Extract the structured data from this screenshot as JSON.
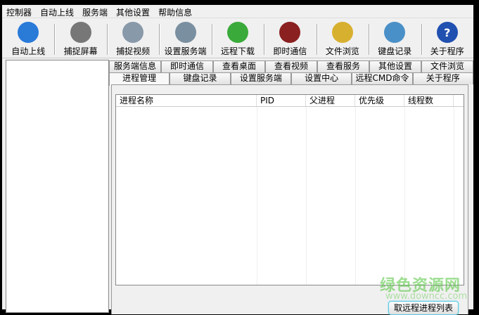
{
  "menu": [
    "控制器",
    "自动上线",
    "服务端",
    "其他设置",
    "帮助信息"
  ],
  "toolbar": [
    {
      "label": "自动上线",
      "icon": "globe-icon",
      "color": "#2a7ad8"
    },
    {
      "label": "捕捉屏幕",
      "icon": "camera-icon",
      "color": "#777"
    },
    {
      "label": "捕捉视频",
      "icon": "webcam-icon",
      "color": "#8899aa"
    },
    {
      "label": "设置服务端",
      "icon": "toolbox-icon",
      "color": "#7a8fa0"
    },
    {
      "label": "远程下载",
      "icon": "download-icon",
      "color": "#3aaa3a"
    },
    {
      "label": "即时通信",
      "icon": "heart-icon",
      "color": "#8a2020"
    },
    {
      "label": "文件浏览",
      "icon": "folder-icon",
      "color": "#d8b030"
    },
    {
      "label": "键盘记录",
      "icon": "computer-icon",
      "color": "#4a90c8"
    },
    {
      "label": "关于程序",
      "icon": "help-icon",
      "color": "#2050b0"
    }
  ],
  "tabs_row1": [
    "服务端信息",
    "即时通信",
    "查看桌面",
    "查看视频",
    "查看服务",
    "其他设置",
    "文件浏览"
  ],
  "tabs_row2": [
    "进程管理",
    "键盘记录",
    "设置服务端",
    "设置中心",
    "远程CMD命令",
    "关于程序"
  ],
  "active_tab": "进程管理",
  "columns": [
    "进程名称",
    "PID",
    "父进程",
    "优先级",
    "线程数"
  ],
  "button": "取远程进程列表",
  "watermark": {
    "title": "绿色资源网",
    "url": "www.downcc.com"
  }
}
